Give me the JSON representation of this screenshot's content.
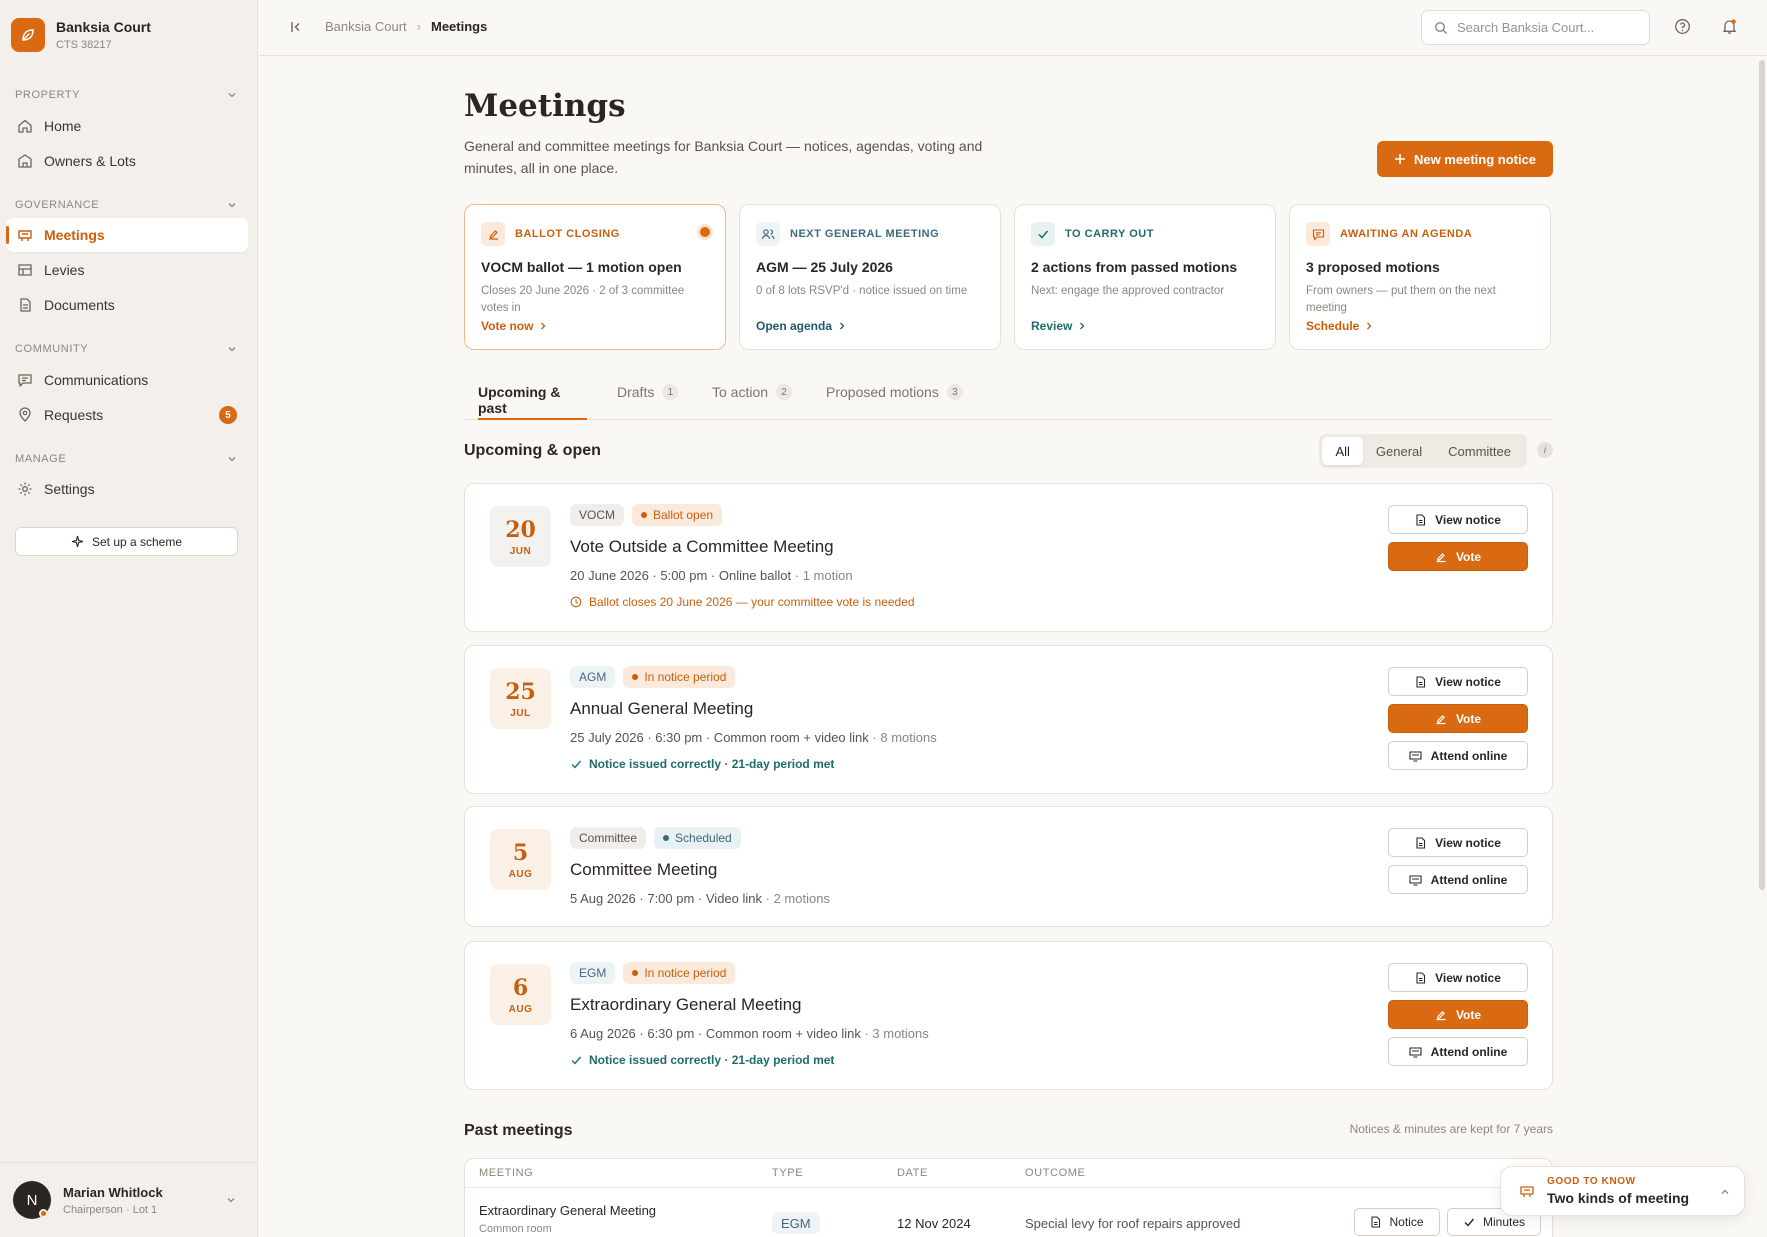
{
  "brand": {
    "name": "Banksia Court",
    "sub": "CTS 38217"
  },
  "sidebar": {
    "sections": [
      {
        "label": "PROPERTY"
      },
      {
        "label": "GOVERNANCE"
      },
      {
        "label": "COMMUNITY"
      },
      {
        "label": "MANAGE"
      }
    ],
    "items": [
      {
        "label": "Home",
        "icon": "home-icon"
      },
      {
        "label": "Owners & Lots",
        "icon": "building-icon"
      },
      {
        "label": "Meetings",
        "icon": "podium-icon",
        "active": true
      },
      {
        "label": "Levies",
        "icon": "table-icon"
      },
      {
        "label": "Documents",
        "icon": "document-icon"
      },
      {
        "label": "Communications",
        "icon": "message-icon"
      },
      {
        "label": "Requests",
        "icon": "pin-icon",
        "badge": "5"
      },
      {
        "label": "Settings",
        "icon": "gear-icon"
      }
    ],
    "setup_label": "Set up a scheme"
  },
  "user": {
    "initial": "N",
    "name": "Marian Whitlock",
    "role": "Chairperson · Lot 1"
  },
  "topbar": {
    "crumbs": [
      "Banksia Court",
      "Meetings"
    ],
    "search_placeholder": "Search Banksia Court..."
  },
  "page": {
    "title": "Meetings",
    "description": "General and committee meetings for Banksia Court — notices, agendas, voting and minutes, all in one place.",
    "new_button": "New meeting notice"
  },
  "summary": [
    {
      "kicker": "BALLOT CLOSING",
      "title": "VOCM ballot — 1 motion open",
      "sub": "Closes 20 June 2026 · 2 of 3 committee votes in",
      "link": "Vote now"
    },
    {
      "kicker": "NEXT GENERAL MEETING",
      "title": "AGM — 25 July 2026",
      "sub": "0 of 8 lots RSVP'd · notice issued on time",
      "link": "Open agenda"
    },
    {
      "kicker": "TO CARRY OUT",
      "title": "2 actions from passed motions",
      "sub": "Next: engage the approved contractor",
      "link": "Review"
    },
    {
      "kicker": "AWAITING AN AGENDA",
      "title": "3 proposed motions",
      "sub": "From owners — put them on the next meeting",
      "link": "Schedule"
    }
  ],
  "tabs": [
    {
      "label": "Upcoming & past",
      "count": ""
    },
    {
      "label": "Drafts",
      "count": "1"
    },
    {
      "label": "To action",
      "count": "2"
    },
    {
      "label": "Proposed motions",
      "count": "3"
    }
  ],
  "upcoming": {
    "title": "Upcoming & open",
    "filters": [
      "All",
      "General",
      "Committee"
    ],
    "info": "i"
  },
  "meetings": [
    {
      "day": "20",
      "month": "JUN",
      "type": "VOCM",
      "status": "Ballot open",
      "title": "Vote Outside a Committee Meeting",
      "meta": "20 June 2026 · 5:00 pm · Online ballot",
      "motions": "· 1 motion",
      "note": "Ballot closes 20 June 2026 — your committee vote is needed"
    },
    {
      "day": "25",
      "month": "JUL",
      "type": "AGM",
      "status": "In notice period",
      "title": "Annual General Meeting",
      "meta": "25 July 2026 · 6:30 pm · Common room + video link",
      "motions": "· 8 motions",
      "note": "Notice issued correctly · 21-day period met"
    },
    {
      "day": "5",
      "month": "AUG",
      "type": "Committee",
      "status": "Scheduled",
      "title": "Committee Meeting",
      "meta": "5 Aug 2026 · 7:00 pm · Video link",
      "motions": "· 2 motions",
      "note": ""
    },
    {
      "day": "6",
      "month": "AUG",
      "type": "EGM",
      "status": "In notice period",
      "title": "Extraordinary General Meeting",
      "meta": "6 Aug 2026 · 6:30 pm · Common room + video link",
      "motions": "· 3 motions",
      "note": "Notice issued correctly · 21-day period met"
    }
  ],
  "actions": {
    "view": "View notice",
    "vote": "Vote",
    "attend": "Attend online"
  },
  "past": {
    "title": "Past meetings",
    "note": "Notices & minutes are kept for 7 years",
    "columns": [
      "MEETING",
      "TYPE",
      "DATE",
      "OUTCOME"
    ],
    "rows": [
      {
        "meeting": "Extraordinary General Meeting",
        "location": "Common room",
        "type": "EGM",
        "date": "12 Nov 2024",
        "outcome": "Special levy for roof repairs approved",
        "notice": "Notice",
        "minutes": "Minutes"
      }
    ]
  },
  "toast": {
    "kicker": "GOOD TO KNOW",
    "title": "Two kinds of meeting"
  },
  "colors": {
    "accent": "#d96a12",
    "teal": "#1f6b6b"
  }
}
